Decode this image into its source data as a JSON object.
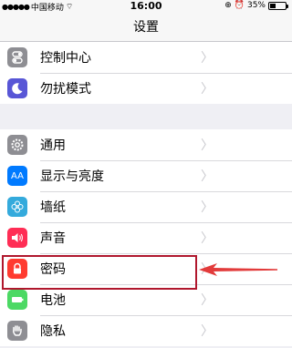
{
  "status_bar": {
    "carrier": "中国移动",
    "time": "16:00",
    "battery_percent": "35%",
    "battery_level": 0.35
  },
  "nav": {
    "title": "设置"
  },
  "groups": [
    {
      "items": [
        {
          "label": "控制中心",
          "icon": "control-center-icon",
          "color": "#8e8e93"
        },
        {
          "label": "勿扰模式",
          "icon": "moon-icon",
          "color": "#5856d6"
        }
      ]
    },
    {
      "items": [
        {
          "label": "通用",
          "icon": "gear-icon",
          "color": "#8e8e93"
        },
        {
          "label": "显示与亮度",
          "icon": "text-size-icon",
          "color": "#007aff"
        },
        {
          "label": "墙纸",
          "icon": "flower-icon",
          "color": "#34aadc"
        },
        {
          "label": "声音",
          "icon": "speaker-icon",
          "color": "#ff2d55"
        },
        {
          "label": "密码",
          "icon": "lock-icon",
          "color": "#ff3b30"
        },
        {
          "label": "电池",
          "icon": "battery-icon",
          "color": "#4cd964"
        },
        {
          "label": "隐私",
          "icon": "hand-icon",
          "color": "#8e8e93"
        }
      ]
    }
  ],
  "annotation": {
    "highlight_color": "#b0172d",
    "arrow_color": "#e23b3b"
  }
}
